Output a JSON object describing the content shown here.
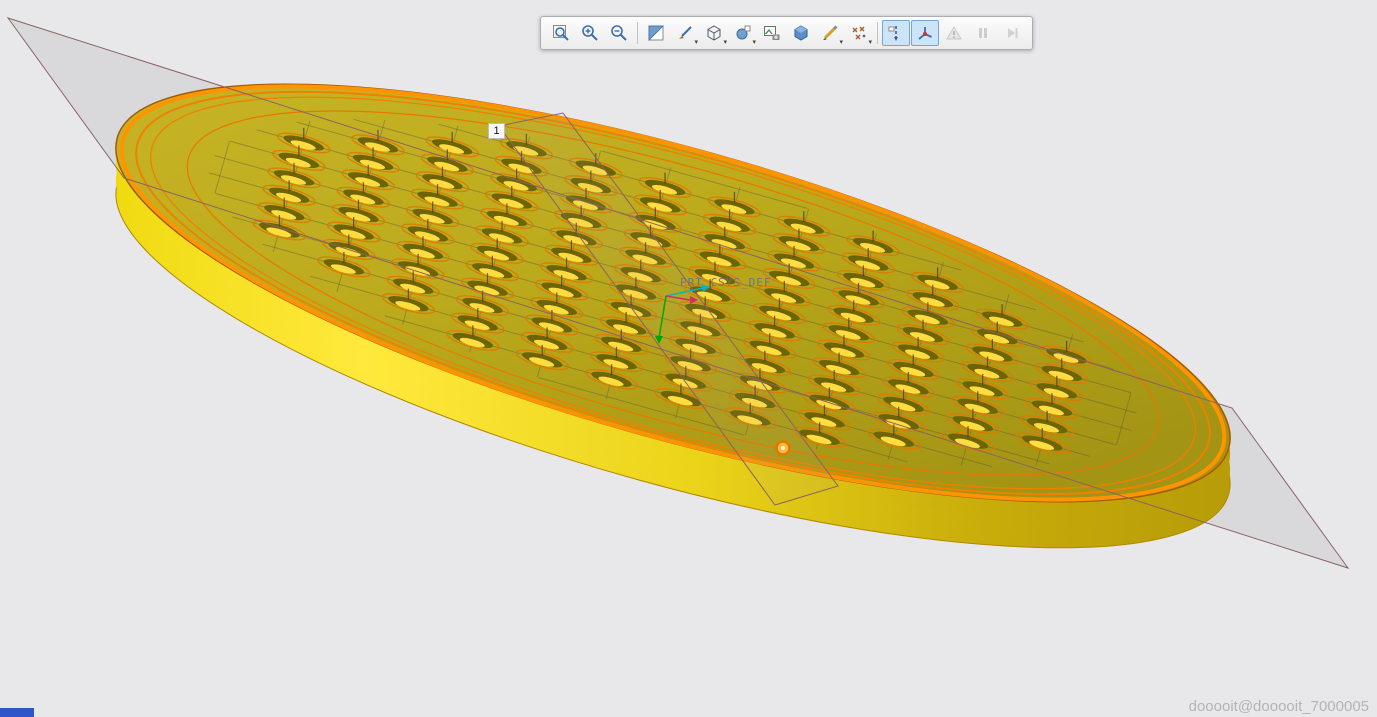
{
  "app": {
    "background_color": "#e8e8ea",
    "watermark": "dooooit@dooooit_7000005"
  },
  "toolbar": {
    "buttons": [
      {
        "name": "zoom-fit",
        "icon": "zoom-fit-icon",
        "state": "normal"
      },
      {
        "name": "zoom-in",
        "icon": "zoom-in-icon",
        "state": "normal"
      },
      {
        "name": "zoom-out",
        "icon": "zoom-out-icon",
        "state": "normal"
      },
      {
        "name": "repaint",
        "icon": "repaint-icon",
        "state": "normal"
      },
      {
        "name": "display-cleanup",
        "icon": "brush-icon",
        "state": "normal"
      },
      {
        "name": "display-style",
        "icon": "cube-icon",
        "state": "normal"
      },
      {
        "name": "saved-orientations",
        "icon": "orientation-icon",
        "state": "normal"
      },
      {
        "name": "capture-image",
        "icon": "camera-icon",
        "state": "normal"
      },
      {
        "name": "view-manager",
        "icon": "blue-cube-icon",
        "state": "normal"
      },
      {
        "name": "annotation-display",
        "icon": "pencil-icon",
        "state": "normal"
      },
      {
        "name": "datum-point-display",
        "icon": "points-icon",
        "state": "normal"
      },
      {
        "name": "axis-display",
        "icon": "axis-icon",
        "state": "active"
      },
      {
        "name": "csys-display",
        "icon": "csys-icon",
        "state": "active"
      },
      {
        "name": "warnings",
        "icon": "warning-icon",
        "state": "disabled"
      },
      {
        "name": "pause",
        "icon": "pause-icon",
        "state": "disabled"
      },
      {
        "name": "resume",
        "icon": "resume-icon",
        "state": "disabled"
      }
    ]
  },
  "viewport": {
    "csys_label": "PRT_CSYS_DEF",
    "datum_tag": "1",
    "colors": {
      "disc_top": "#bcab1c",
      "disc_side": "#ffe93c",
      "rim_orange": "#ff9400",
      "plane_edge": "#8a6363",
      "hole_dark": "#6e6406",
      "hole_light": "#ffdc40",
      "active_button_bg": "#cde3f6"
    }
  }
}
